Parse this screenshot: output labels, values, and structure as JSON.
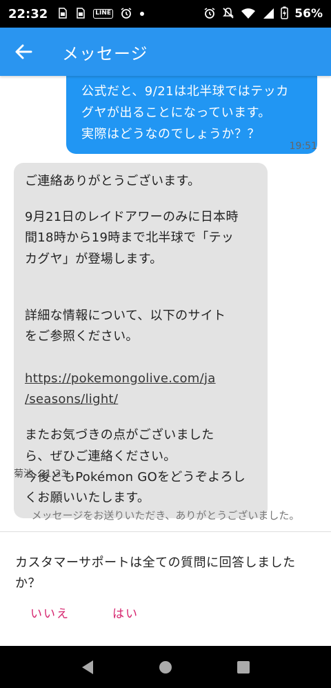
{
  "status_bar": {
    "time": "22:32",
    "left_icons": [
      "sim-icon",
      "sim-icon",
      "line-icon",
      "alarm-icon",
      "dot-icon"
    ],
    "right_icons": [
      "alarm-icon",
      "mute-icon",
      "wifi-icon",
      "signal-icon",
      "battery-icon"
    ],
    "battery": "56%"
  },
  "app_bar": {
    "title": "メッセージ",
    "color": "#2a95f0"
  },
  "messages": {
    "outgoing": {
      "text": "公式だと、9/21は北半球ではテッカ\nグヤが出ることになっています。\n実際はどうなのでしょうか？？",
      "time": "19:51",
      "color": "#2196f3"
    },
    "incoming": {
      "greeting": "ご連絡ありがとうございます。",
      "body1": "9月21日のレイドアワーのみに日本時\n間18時から19時まで北半球で「テッ\nカグヤ」が登場します。",
      "body2": "詳細な情報について、以下のサイト\nをご参照ください。",
      "link": "https://pokemongolive.com/ja\n/seasons/light/",
      "body3": "またお気づきの点がございました\nら、ぜひご連絡ください。\n今後ともPokémon GOをどうぞよろし\nくお願いいたします。",
      "sender_meta": "菊池, 21:33",
      "color": "#e3e3e3"
    },
    "system": "メッセージをお送りいただき、ありがとうございました。"
  },
  "survey": {
    "question": "カスタマーサポートは全ての質問に回答しました\nか？",
    "no_label": "いいえ",
    "yes_label": "はい",
    "accent": "#d6246e"
  },
  "nav_bar": {
    "icons": [
      "back-triangle-icon",
      "home-circle-icon",
      "recents-square-icon"
    ]
  }
}
